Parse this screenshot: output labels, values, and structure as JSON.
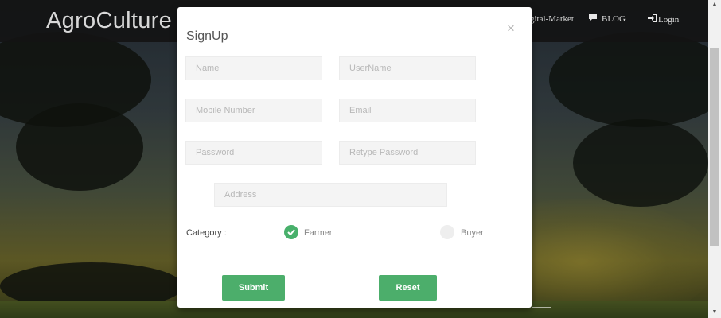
{
  "navbar": {
    "brand": "AgroCulture",
    "links": [
      {
        "label": "gital-Market"
      },
      {
        "label": "BLOG",
        "icon": "comment-icon"
      },
      {
        "label": "Login",
        "icon": "login-icon"
      }
    ]
  },
  "modal": {
    "title": "SignUp",
    "close_glyph": "×",
    "fields": {
      "name": {
        "placeholder": "Name",
        "value": ""
      },
      "username": {
        "placeholder": "UserName",
        "value": ""
      },
      "mobile": {
        "placeholder": "Mobile Number",
        "value": ""
      },
      "email": {
        "placeholder": "Email",
        "value": ""
      },
      "password": {
        "placeholder": "Password",
        "value": ""
      },
      "retype_password": {
        "placeholder": "Retype Password",
        "value": ""
      },
      "address": {
        "placeholder": "Address",
        "value": ""
      }
    },
    "category": {
      "label": "Category :",
      "options": [
        {
          "label": "Farmer",
          "selected": true
        },
        {
          "label": "Buyer",
          "selected": false
        }
      ]
    },
    "buttons": {
      "submit": "Submit",
      "reset": "Reset"
    }
  },
  "colors": {
    "accent": "#4cae6b",
    "navbar_bg": "#141414",
    "brand_text": "#d8d8d8"
  }
}
